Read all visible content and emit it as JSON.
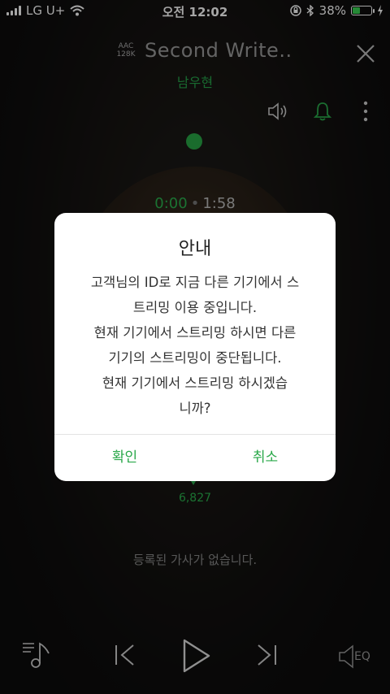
{
  "status_bar": {
    "carrier": "LG U+",
    "time": "오전 12:02",
    "battery_percent": "38%",
    "battery_level": 0.38
  },
  "player": {
    "quality_line1": "AAC",
    "quality_line2": "128K",
    "song_title": "Second Write..",
    "artist": "남우현",
    "current_time": "0:00",
    "total_time": "1:58",
    "like_count": "6,827",
    "lyrics_empty": "등록된 가사가 없습니다.",
    "eq_label": "EQ"
  },
  "dialog": {
    "title": "안내",
    "message": "고객님의 ID로 지금 다른 기기에서 스\n트리밍 이용 중입니다.\n현재 기기에서 스트리밍 하시면 다른\n기기의 스트리밍이 중단됩니다.\n현재 기기에서 스트리밍 하시겠습\n니까?",
    "confirm_label": "확인",
    "cancel_label": "취소"
  },
  "colors": {
    "accent": "#2aa84a",
    "dialog_bg": "#ffffff"
  },
  "icons": [
    "wifi-icon",
    "lock-rotation-icon",
    "bluetooth-icon",
    "battery-icon",
    "charging-icon",
    "close-icon",
    "speaker-icon",
    "bell-icon",
    "more-icon",
    "playlist-icon",
    "prev-icon",
    "play-icon",
    "next-icon",
    "eq-icon",
    "heart-icon"
  ]
}
